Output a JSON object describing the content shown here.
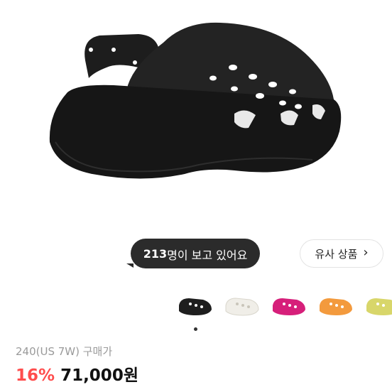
{
  "hero": {
    "image": "black platform clog"
  },
  "viewers": {
    "count": "213",
    "text": "명이 보고 있어요"
  },
  "similar_button": {
    "label": "유사 상품",
    "icon": "chevron-right-icon"
  },
  "colors": {
    "pill_bg": "#2b2b2b",
    "discount": "#ff4d4d",
    "swatches": [
      "#1e1e1e",
      "#f0eee8",
      "#d61f7a",
      "#f39a3d",
      "#d8d66a"
    ]
  },
  "thumbnails": [
    "black",
    "white",
    "pink",
    "orange",
    "lime"
  ],
  "product": {
    "size_label": "240(US 7W) 구매가",
    "discount": "16%",
    "price": "71,000원"
  }
}
